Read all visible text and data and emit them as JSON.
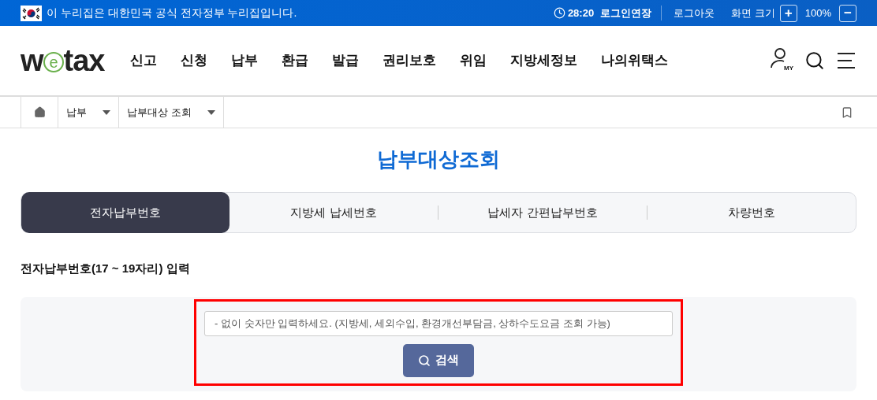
{
  "gov_banner": {
    "text": "이 누리집은 대한민국 공식 전자정부 누리집입니다.",
    "timer": "28:20",
    "extend": "로그인연장",
    "logout": "로그아웃",
    "zoom_label": "화면 크기",
    "zoom_in": "+",
    "zoom_value": "100%",
    "zoom_out": "−"
  },
  "header": {
    "logo": {
      "before": "w",
      "mark": "e",
      "after": "tax"
    },
    "nav": [
      "신고",
      "신청",
      "납부",
      "환급",
      "발급",
      "권리보호",
      "위임",
      "지방세정보",
      "나의위택스"
    ],
    "my_badge": "MY"
  },
  "breadcrumb": [
    "납부",
    "납부대상 조회"
  ],
  "page_title": "납부대상조회",
  "tabs": [
    {
      "label": "전자납부번호",
      "selected": true
    },
    {
      "label": "지방세 납세번호",
      "selected": false
    },
    {
      "label": "납세자 간편납부번호",
      "selected": false
    },
    {
      "label": "차량번호",
      "selected": false
    }
  ],
  "section_title": "전자납부번호(17 ~ 19자리) 입력",
  "search": {
    "placeholder": "- 없이 숫자만 입력하세요. (지방세, 세외수입, 환경개선부담금, 상하수도요금 조회 가능)",
    "button": "검색",
    "highlighted": true
  }
}
